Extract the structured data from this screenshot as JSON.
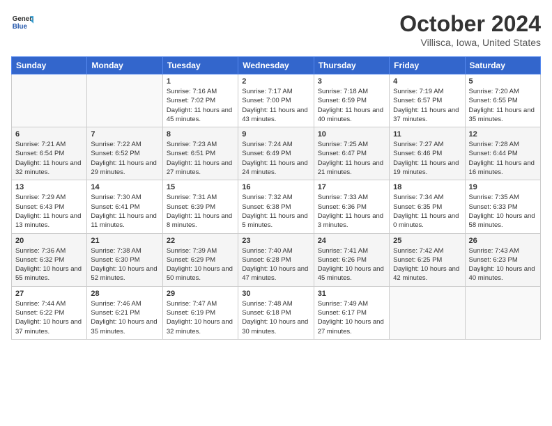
{
  "header": {
    "logo_general": "General",
    "logo_blue": "Blue",
    "month": "October 2024",
    "location": "Villisca, Iowa, United States"
  },
  "weekdays": [
    "Sunday",
    "Monday",
    "Tuesday",
    "Wednesday",
    "Thursday",
    "Friday",
    "Saturday"
  ],
  "weeks": [
    [
      {
        "day": "",
        "info": ""
      },
      {
        "day": "",
        "info": ""
      },
      {
        "day": "1",
        "info": "Sunrise: 7:16 AM\nSunset: 7:02 PM\nDaylight: 11 hours and 45 minutes."
      },
      {
        "day": "2",
        "info": "Sunrise: 7:17 AM\nSunset: 7:00 PM\nDaylight: 11 hours and 43 minutes."
      },
      {
        "day": "3",
        "info": "Sunrise: 7:18 AM\nSunset: 6:59 PM\nDaylight: 11 hours and 40 minutes."
      },
      {
        "day": "4",
        "info": "Sunrise: 7:19 AM\nSunset: 6:57 PM\nDaylight: 11 hours and 37 minutes."
      },
      {
        "day": "5",
        "info": "Sunrise: 7:20 AM\nSunset: 6:55 PM\nDaylight: 11 hours and 35 minutes."
      }
    ],
    [
      {
        "day": "6",
        "info": "Sunrise: 7:21 AM\nSunset: 6:54 PM\nDaylight: 11 hours and 32 minutes."
      },
      {
        "day": "7",
        "info": "Sunrise: 7:22 AM\nSunset: 6:52 PM\nDaylight: 11 hours and 29 minutes."
      },
      {
        "day": "8",
        "info": "Sunrise: 7:23 AM\nSunset: 6:51 PM\nDaylight: 11 hours and 27 minutes."
      },
      {
        "day": "9",
        "info": "Sunrise: 7:24 AM\nSunset: 6:49 PM\nDaylight: 11 hours and 24 minutes."
      },
      {
        "day": "10",
        "info": "Sunrise: 7:25 AM\nSunset: 6:47 PM\nDaylight: 11 hours and 21 minutes."
      },
      {
        "day": "11",
        "info": "Sunrise: 7:27 AM\nSunset: 6:46 PM\nDaylight: 11 hours and 19 minutes."
      },
      {
        "day": "12",
        "info": "Sunrise: 7:28 AM\nSunset: 6:44 PM\nDaylight: 11 hours and 16 minutes."
      }
    ],
    [
      {
        "day": "13",
        "info": "Sunrise: 7:29 AM\nSunset: 6:43 PM\nDaylight: 11 hours and 13 minutes."
      },
      {
        "day": "14",
        "info": "Sunrise: 7:30 AM\nSunset: 6:41 PM\nDaylight: 11 hours and 11 minutes."
      },
      {
        "day": "15",
        "info": "Sunrise: 7:31 AM\nSunset: 6:39 PM\nDaylight: 11 hours and 8 minutes."
      },
      {
        "day": "16",
        "info": "Sunrise: 7:32 AM\nSunset: 6:38 PM\nDaylight: 11 hours and 5 minutes."
      },
      {
        "day": "17",
        "info": "Sunrise: 7:33 AM\nSunset: 6:36 PM\nDaylight: 11 hours and 3 minutes."
      },
      {
        "day": "18",
        "info": "Sunrise: 7:34 AM\nSunset: 6:35 PM\nDaylight: 11 hours and 0 minutes."
      },
      {
        "day": "19",
        "info": "Sunrise: 7:35 AM\nSunset: 6:33 PM\nDaylight: 10 hours and 58 minutes."
      }
    ],
    [
      {
        "day": "20",
        "info": "Sunrise: 7:36 AM\nSunset: 6:32 PM\nDaylight: 10 hours and 55 minutes."
      },
      {
        "day": "21",
        "info": "Sunrise: 7:38 AM\nSunset: 6:30 PM\nDaylight: 10 hours and 52 minutes."
      },
      {
        "day": "22",
        "info": "Sunrise: 7:39 AM\nSunset: 6:29 PM\nDaylight: 10 hours and 50 minutes."
      },
      {
        "day": "23",
        "info": "Sunrise: 7:40 AM\nSunset: 6:28 PM\nDaylight: 10 hours and 47 minutes."
      },
      {
        "day": "24",
        "info": "Sunrise: 7:41 AM\nSunset: 6:26 PM\nDaylight: 10 hours and 45 minutes."
      },
      {
        "day": "25",
        "info": "Sunrise: 7:42 AM\nSunset: 6:25 PM\nDaylight: 10 hours and 42 minutes."
      },
      {
        "day": "26",
        "info": "Sunrise: 7:43 AM\nSunset: 6:23 PM\nDaylight: 10 hours and 40 minutes."
      }
    ],
    [
      {
        "day": "27",
        "info": "Sunrise: 7:44 AM\nSunset: 6:22 PM\nDaylight: 10 hours and 37 minutes."
      },
      {
        "day": "28",
        "info": "Sunrise: 7:46 AM\nSunset: 6:21 PM\nDaylight: 10 hours and 35 minutes."
      },
      {
        "day": "29",
        "info": "Sunrise: 7:47 AM\nSunset: 6:19 PM\nDaylight: 10 hours and 32 minutes."
      },
      {
        "day": "30",
        "info": "Sunrise: 7:48 AM\nSunset: 6:18 PM\nDaylight: 10 hours and 30 minutes."
      },
      {
        "day": "31",
        "info": "Sunrise: 7:49 AM\nSunset: 6:17 PM\nDaylight: 10 hours and 27 minutes."
      },
      {
        "day": "",
        "info": ""
      },
      {
        "day": "",
        "info": ""
      }
    ]
  ]
}
